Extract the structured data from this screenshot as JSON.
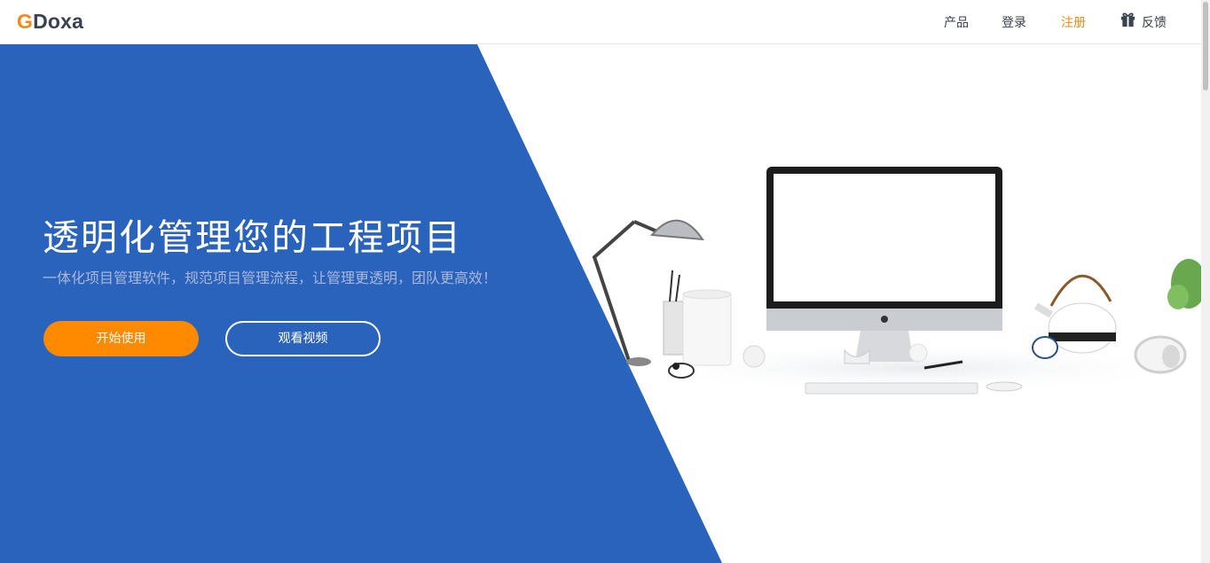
{
  "header": {
    "logo_g": "G",
    "logo_rest": "Doxa",
    "nav": {
      "product": "产品",
      "login": "登录",
      "register": "注册",
      "feedback": "反馈"
    }
  },
  "hero": {
    "title": "透明化管理您的工程项目",
    "subtitle": "一体化项目管理软件，规范项目管理流程，让管理更透明，团队更高效！",
    "start_button": "开始使用",
    "video_button": "观看视频"
  },
  "colors": {
    "brand_orange": "#f28a16",
    "hero_blue": "#2a63bc",
    "button_orange": "#ff8a00"
  },
  "icons": {
    "feedback": "gift-icon"
  }
}
